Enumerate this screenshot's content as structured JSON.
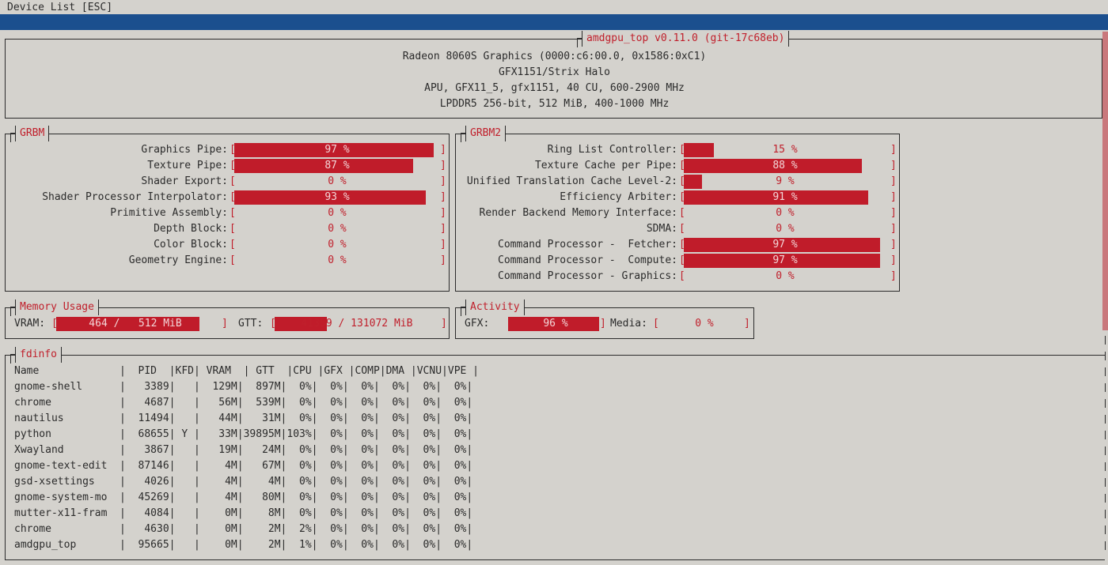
{
  "topbar": {
    "label": "Device List [ESC]"
  },
  "header": {
    "title": "amdgpu_top v0.11.0 (git-17c68eb)",
    "lines": [
      "Radeon 8060S Graphics (0000:c6:00.0, 0x1586:0xC1)",
      "GFX1151/Strix Halo",
      "APU, GFX11_5, gfx1151, 40 CU, 600-2900 MHz",
      "LPDDR5 256-bit, 512 MiB, 400-1000 MHz"
    ]
  },
  "grbm": {
    "title": "GRBM",
    "rows": [
      {
        "label": "Graphics Pipe:",
        "value": "97 %",
        "pct": 97
      },
      {
        "label": "Texture Pipe:",
        "value": "87 %",
        "pct": 87
      },
      {
        "label": "Shader Export:",
        "value": "0 %",
        "pct": 0
      },
      {
        "label": "Shader Processor Interpolator:",
        "value": "93 %",
        "pct": 93
      },
      {
        "label": "Primitive Assembly:",
        "value": "0 %",
        "pct": 0
      },
      {
        "label": "Depth Block:",
        "value": "0 %",
        "pct": 0
      },
      {
        "label": "Color Block:",
        "value": "0 %",
        "pct": 0
      },
      {
        "label": "Geometry Engine:",
        "value": "0 %",
        "pct": 0
      }
    ]
  },
  "grbm2": {
    "title": "GRBM2",
    "rows": [
      {
        "label": "Ring List Controller:",
        "value": "15 %",
        "pct": 15
      },
      {
        "label": "Texture Cache per Pipe:",
        "value": "88 %",
        "pct": 88
      },
      {
        "label": "Unified Translation Cache Level-2:",
        "value": "9 %",
        "pct": 9
      },
      {
        "label": "Efficiency Arbiter:",
        "value": "91 %",
        "pct": 91
      },
      {
        "label": "Render Backend Memory Interface:",
        "value": "0 %",
        "pct": 0
      },
      {
        "label": "SDMA:",
        "value": "0 %",
        "pct": 0
      },
      {
        "label": "Command Processor -  Fetcher:",
        "value": "97 %",
        "pct": 97
      },
      {
        "label": "Command Processor -  Compute:",
        "value": "97 %",
        "pct": 97
      },
      {
        "label": "Command Processor - Graphics:",
        "value": "0 %",
        "pct": 0
      }
    ]
  },
  "memory": {
    "title": "Memory Usage",
    "vram_label": "VRAM:",
    "vram_value": "464 /   512 MiB",
    "vram_pct": 90.6,
    "gtt_label": "GTT:",
    "gtt_value": "41359 / 131072 MiB",
    "gtt_pct": 31.6
  },
  "activity": {
    "title": "Activity",
    "gfx_label": "GFX:",
    "gfx_value": "96 %",
    "gfx_pct": 96,
    "media_label": "Media:",
    "media_value": "0 %",
    "media_pct": 0
  },
  "fdinfo": {
    "title": "fdinfo",
    "header": "Name             |  PID  |KFD| VRAM  | GTT  |CPU |GFX |COMP|DMA |VCNU|VPE |",
    "rows": [
      "gnome-shell      |   3389|   |  129M|  897M|  0%|  0%|  0%|  0%|  0%|  0%|",
      "chrome           |   4687|   |   56M|  539M|  0%|  0%|  0%|  0%|  0%|  0%|",
      "nautilus         |  11494|   |   44M|   31M|  0%|  0%|  0%|  0%|  0%|  0%|",
      "python           |  68655| Y |   33M|39895M|103%|  0%|  0%|  0%|  0%|  0%|",
      "Xwayland         |   3867|   |   19M|   24M|  0%|  0%|  0%|  0%|  0%|  0%|",
      "gnome-text-edit  |  87146|   |    4M|   67M|  0%|  0%|  0%|  0%|  0%|  0%|",
      "gsd-xsettings    |   4026|   |    4M|    4M|  0%|  0%|  0%|  0%|  0%|  0%|",
      "gnome-system-mo  |  45269|   |    4M|   80M|  0%|  0%|  0%|  0%|  0%|  0%|",
      "mutter-x11-fram  |   4084|   |    0M|    8M|  0%|  0%|  0%|  0%|  0%|  0%|",
      "chrome           |   4630|   |    0M|    2M|  2%|  0%|  0%|  0%|  0%|  0%|",
      "amdgpu_top       |  95665|   |    0M|    2M|  1%|  0%|  0%|  0%|  0%|  0%|"
    ]
  },
  "colors": {
    "accent": "#c01c2a",
    "header_bar": "#1b4f8e",
    "background": "#d4d2cd",
    "text": "#2b2b2b"
  }
}
